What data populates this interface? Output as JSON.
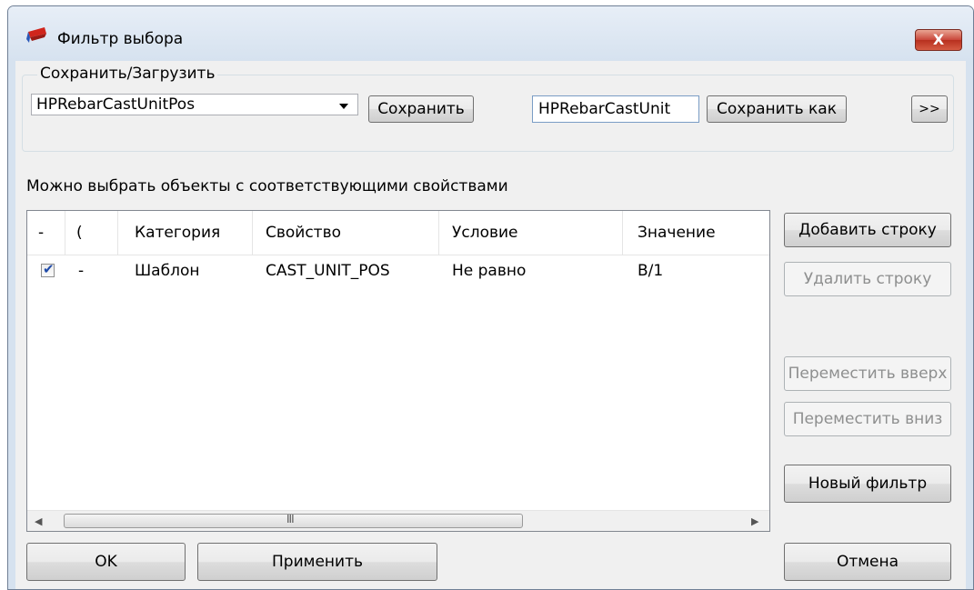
{
  "window": {
    "title": "Фильтр выбора",
    "close_glyph": "X"
  },
  "save_load": {
    "legend": "Сохранить/Загрузить",
    "combo_value": "HPRebarCastUnitPos",
    "save_button": "Сохранить",
    "name_value": "HPRebarCastUnit",
    "save_as_button": "Сохранить как",
    "expand_button": ">>"
  },
  "hint": "Можно выбрать объекты с соответствующими свойствами",
  "table": {
    "headers": [
      "-",
      "(",
      "Категория",
      "Свойство",
      "Условие",
      "Значение"
    ],
    "rows": [
      {
        "checked": true,
        "paren": "-",
        "category": "Шаблон",
        "property": "CAST_UNIT_POS",
        "condition": "Не равно",
        "value": "B/1"
      }
    ],
    "scroll_grip": "III"
  },
  "side_buttons": {
    "add_row": "Добавить строку",
    "delete_row": "Удалить строку",
    "move_up": "Переместить вверх",
    "move_down": "Переместить вниз",
    "new_filter": "Новый фильтр"
  },
  "bottom_buttons": {
    "ok": "OK",
    "apply": "Применить",
    "cancel": "Отмена"
  },
  "icons": {
    "app": "filter-app-icon",
    "close": "close-icon",
    "dropdown": "chevron-down-icon",
    "check": "check-icon"
  },
  "colors": {
    "close_button": "#c9463a",
    "title_bar": "#d6e2ef",
    "client": "#f0f0f0",
    "check": "#1e4aa8"
  }
}
